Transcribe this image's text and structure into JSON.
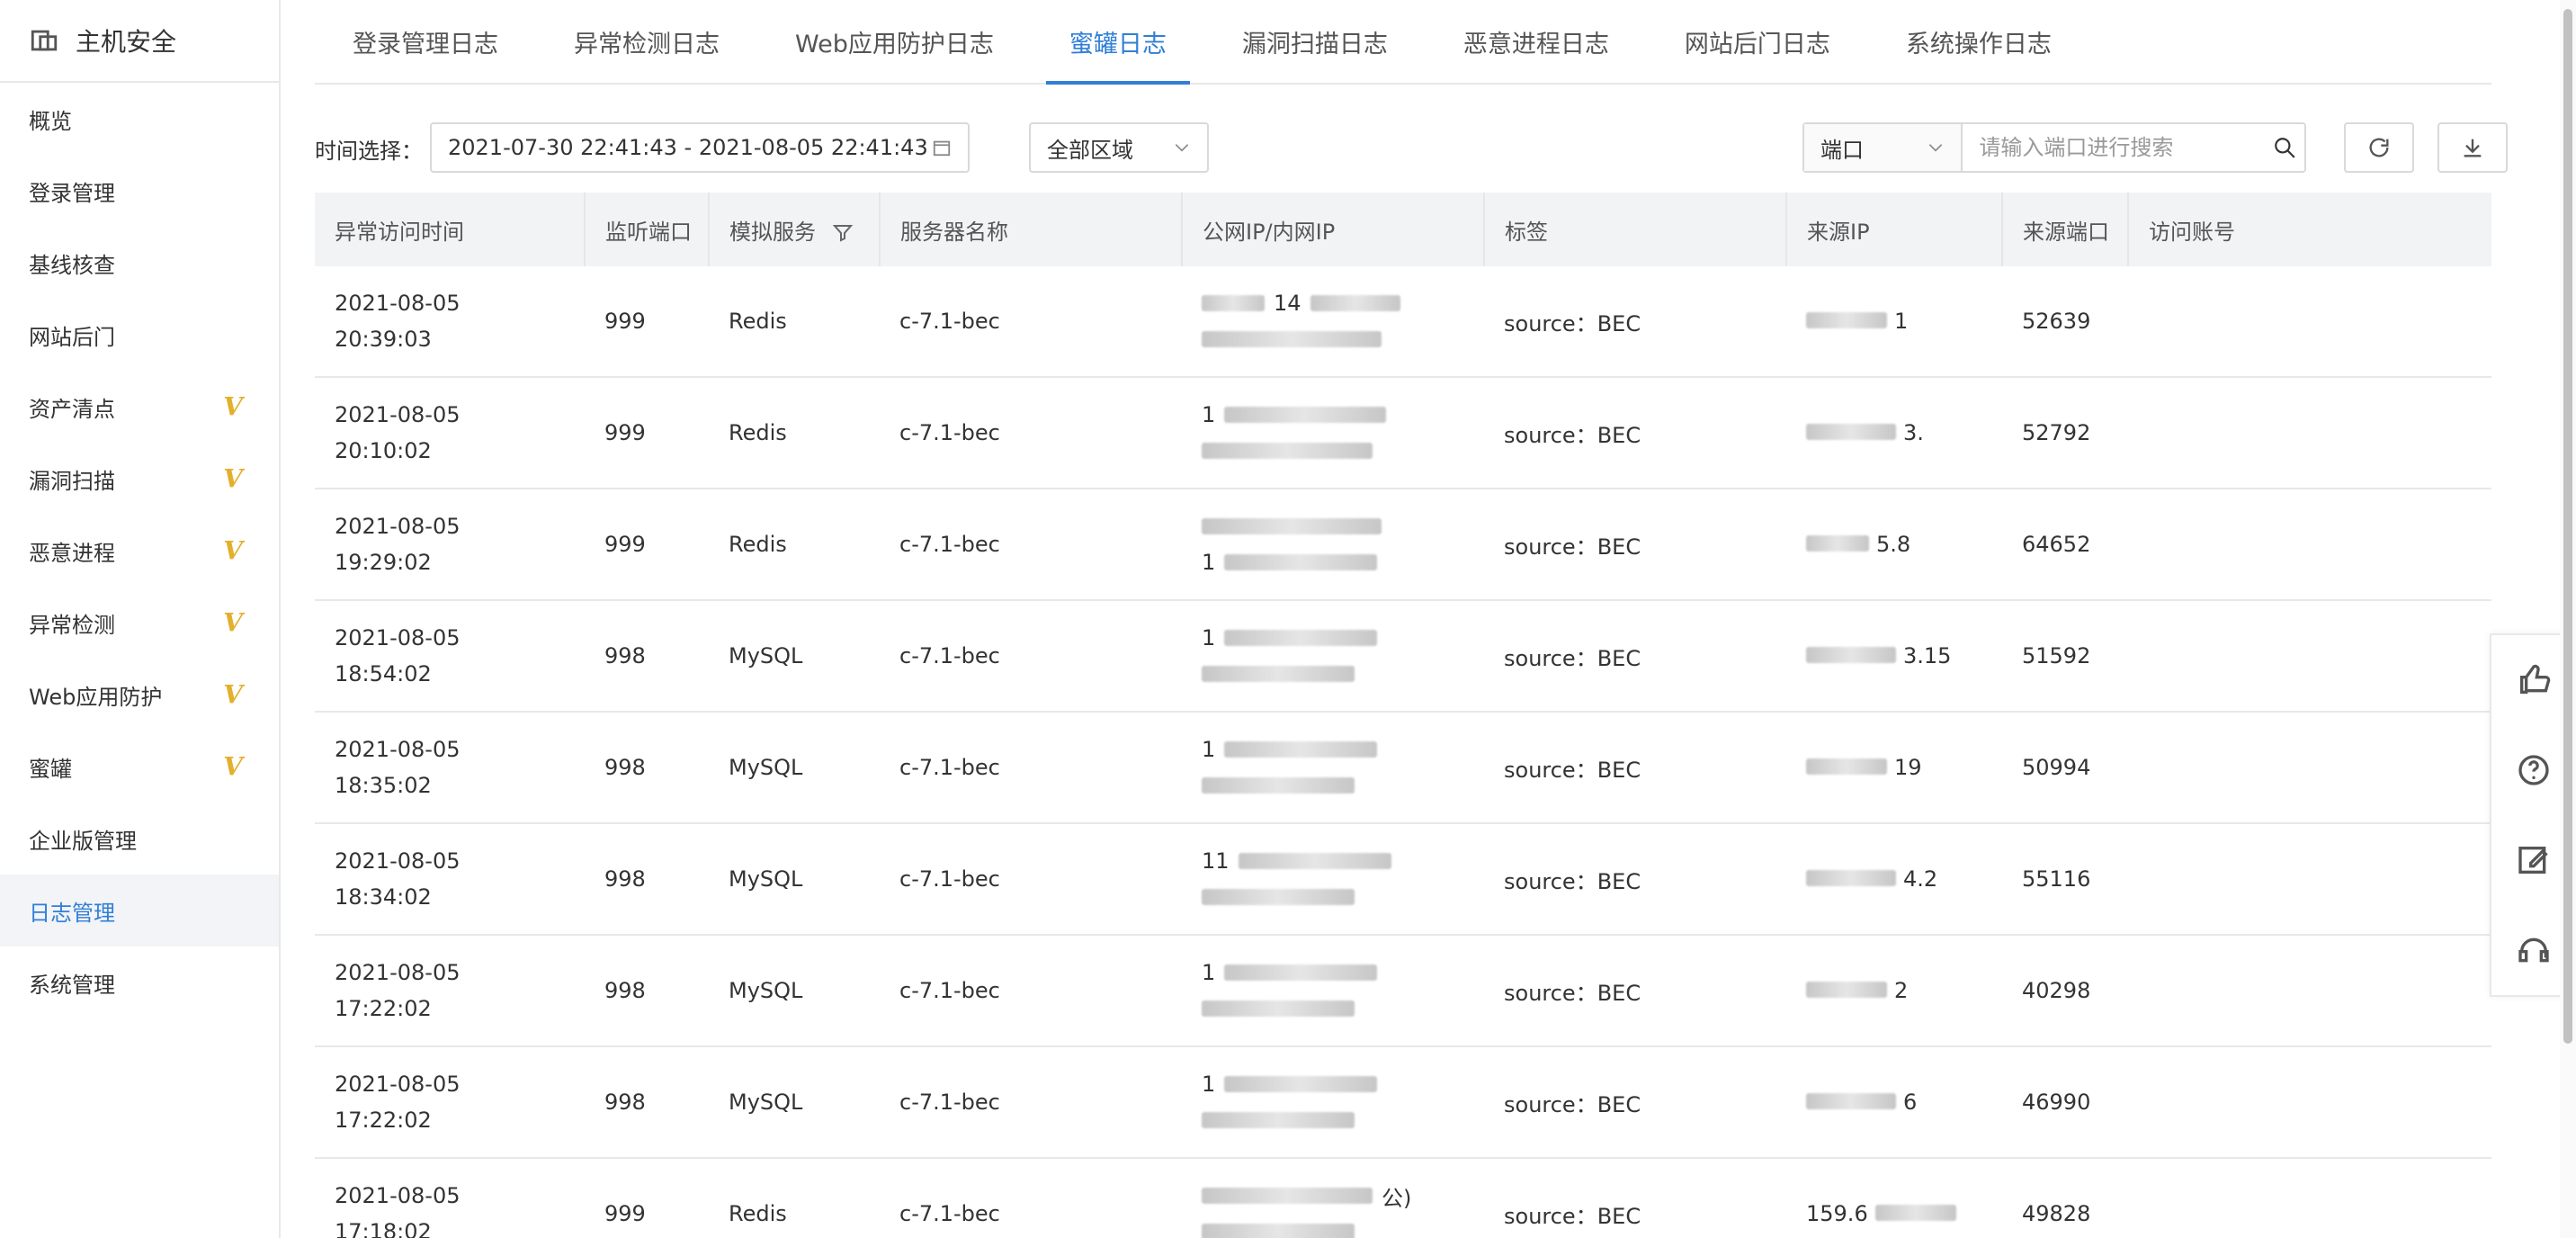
{
  "app": {
    "title": "主机安全"
  },
  "sidebar": {
    "items": [
      {
        "label": "概览",
        "badge": ""
      },
      {
        "label": "登录管理",
        "badge": ""
      },
      {
        "label": "基线核查",
        "badge": ""
      },
      {
        "label": "网站后门",
        "badge": ""
      },
      {
        "label": "资产清点",
        "badge": "V"
      },
      {
        "label": "漏洞扫描",
        "badge": "V"
      },
      {
        "label": "恶意进程",
        "badge": "V"
      },
      {
        "label": "异常检测",
        "badge": "V"
      },
      {
        "label": "Web应用防护",
        "badge": "V"
      },
      {
        "label": "蜜罐",
        "badge": "V"
      },
      {
        "label": "企业版管理",
        "badge": ""
      },
      {
        "label": "日志管理",
        "badge": ""
      },
      {
        "label": "系统管理",
        "badge": ""
      }
    ],
    "active": "日志管理"
  },
  "tabs": [
    "登录管理日志",
    "异常检测日志",
    "Web应用防护日志",
    "蜜罐日志",
    "漏洞扫描日志",
    "恶意进程日志",
    "网站后门日志",
    "系统操作日志"
  ],
  "active_tab": "蜜罐日志",
  "filters": {
    "time_label": "时间选择：",
    "time_range": "2021-07-30 22:41:43 - 2021-08-05 22:41:43",
    "region": "全部区域",
    "search_field": "端口",
    "search_placeholder": "请输入端口进行搜索"
  },
  "table": {
    "columns": [
      "异常访问时间",
      "监听端口",
      "模拟服务",
      "服务器名称",
      "公网IP/内网IP",
      "标签",
      "来源IP",
      "来源端口",
      "访问账号"
    ],
    "rows": [
      {
        "time": "2021-08-05\n20:39:03",
        "port": "999",
        "service": "Redis",
        "server": "c-7.1-bec",
        "ip_hint": "14",
        "tag": "source：BEC",
        "src_ip_hint": "1",
        "src_port": "52639",
        "account": ""
      },
      {
        "time": "2021-08-05\n20:10:02",
        "port": "999",
        "service": "Redis",
        "server": "c-7.1-bec",
        "ip_hint": "1",
        "tag": "source：BEC",
        "src_ip_hint": "3.",
        "src_port": "52792",
        "account": ""
      },
      {
        "time": "2021-08-05\n19:29:02",
        "port": "999",
        "service": "Redis",
        "server": "c-7.1-bec",
        "ip_hint": "1",
        "tag": "source：BEC",
        "src_ip_hint": "5.8",
        "src_port": "64652",
        "account": ""
      },
      {
        "time": "2021-08-05\n18:54:02",
        "port": "998",
        "service": "MySQL",
        "server": "c-7.1-bec",
        "ip_hint": "1",
        "tag": "source：BEC",
        "src_ip_hint": "3.15",
        "src_port": "51592",
        "account": ""
      },
      {
        "time": "2021-08-05\n18:35:02",
        "port": "998",
        "service": "MySQL",
        "server": "c-7.1-bec",
        "ip_hint": "1",
        "tag": "source：BEC",
        "src_ip_hint": "19",
        "src_port": "50994",
        "account": ""
      },
      {
        "time": "2021-08-05\n18:34:02",
        "port": "998",
        "service": "MySQL",
        "server": "c-7.1-bec",
        "ip_hint": "11",
        "tag": "source：BEC",
        "src_ip_hint": "4.2",
        "src_port": "55116",
        "account": ""
      },
      {
        "time": "2021-08-05\n17:22:02",
        "port": "998",
        "service": "MySQL",
        "server": "c-7.1-bec",
        "ip_hint": "1",
        "tag": "source：BEC",
        "src_ip_hint": "2",
        "src_port": "40298",
        "account": ""
      },
      {
        "time": "2021-08-05\n17:22:02",
        "port": "998",
        "service": "MySQL",
        "server": "c-7.1-bec",
        "ip_hint": "1",
        "tag": "source：BEC",
        "src_ip_hint": "6",
        "src_port": "46990",
        "account": ""
      },
      {
        "time": "2021-08-05\n17:18:02",
        "port": "999",
        "service": "Redis",
        "server": "c-7.1-bec",
        "ip_hint": "公)",
        "tag": "source：BEC",
        "src_ip_hint": "159.6",
        "src_port": "49828",
        "account": ""
      }
    ]
  },
  "colors": {
    "accent": "#2f7fd6",
    "badge": "#e3b02c",
    "header_bg": "#f2f3f5",
    "border": "#e8e8e8"
  }
}
